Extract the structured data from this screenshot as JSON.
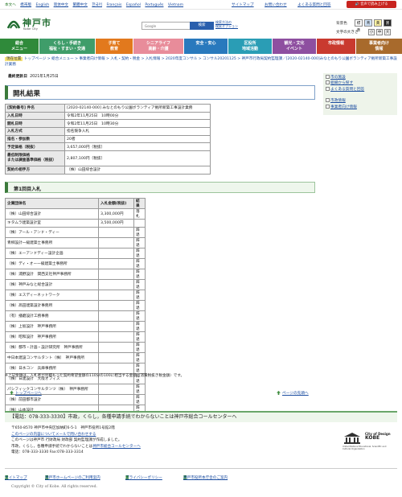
{
  "topbar": {
    "languages": [
      "本文へ",
      "携帯版",
      "English",
      "简体中文",
      "繁體中文",
      "한국어",
      "Français",
      "Español",
      "Português",
      "Vietnam"
    ],
    "links": [
      "サイトマップ",
      "お問い合わせ",
      "よくある質問と回答"
    ],
    "voice_button": "音声で読み上げる"
  },
  "header": {
    "logo_name": "神戸市",
    "logo_sub": "Kobe City",
    "search_placeholder": "Google",
    "search_button": "検索",
    "search_option": "検索方法の\n検索オプション",
    "bgcolor_label": "背景色",
    "bgcolor_options": [
      "標準",
      "青",
      "黄",
      "黒"
    ],
    "fontsize_label": "文字の大きさ",
    "fontsize_options": [
      "小",
      "中",
      "大"
    ]
  },
  "nav": [
    {
      "label": "総合\nメニュー",
      "color": "#2f8a3a"
    },
    {
      "label": "くらし・手続き\n福祉・すまい・交通",
      "color": "#3f9d6a"
    },
    {
      "label": "子育て\n教育",
      "color": "#e2791d"
    },
    {
      "label": "シニアライフ\n高齢・介護",
      "color": "#e88c9a"
    },
    {
      "label": "安全・安心",
      "color": "#2979bd"
    },
    {
      "label": "区役所\n地域活動",
      "color": "#2a9db5"
    },
    {
      "label": "観光・文化\nイベント",
      "color": "#8e4fa0"
    },
    {
      "label": "市政情報",
      "color": "#c93a2f"
    },
    {
      "label": "事業者向け\n情報",
      "color": "#a86a2c"
    }
  ],
  "breadcrumb": {
    "current_label": "現在位置",
    "path": "トップページ > 総合メニュー > 事業者向け情報 > 入札・契約・税金 > 入札情報 > 2020年度コンサル > コンサル20201125 > 神戸市行政局契約監理課／[2020-02140-000]みなとのもり公園ボランティア拠所新築工事設計業務"
  },
  "updated": {
    "label": "最終更新日",
    "date": "2021年1月25日"
  },
  "side_links": [
    "市の施設",
    "組織から探す",
    "よくある質問と回答",
    "市政情報",
    "事業者向け情報"
  ],
  "title": "開札結果",
  "info_table": [
    {
      "key": "[契約番号] 件名",
      "value": "[2020-02140-000] みなとのもり公園ボランティア拠所新築工事設計業務"
    },
    {
      "key": "入札日時",
      "value": "令和2年11月25日　10時00分"
    },
    {
      "key": "開札日時",
      "value": "令和2年11月25日　10時30分"
    },
    {
      "key": "入札方式",
      "value": "指名競争入札"
    },
    {
      "key": "指名・参加数",
      "value": "20者"
    },
    {
      "key": "予定価格（税抜）",
      "value": "3,657,000円（税抜）"
    },
    {
      "key": "最低制限価格\nまたは調査基準価格（税抜）",
      "value": "2,807,100円（税抜）"
    },
    {
      "key": "契約の相手方",
      "value": "（株）山田綜合設計"
    }
  ],
  "round_title": "第1回目入札",
  "results": {
    "headers": [
      "企業団体名",
      "入札金額(税抜)",
      "結果"
    ],
    "rows": [
      [
        "（株）山田綜合設計",
        "3,300,000円",
        "落札"
      ],
      [
        "キタムラ建築設計室",
        "3,500,000円",
        ""
      ],
      [
        "（株）アール・アンド・ディー",
        "",
        "辞退"
      ],
      [
        "青柳設計一級建築士事務所",
        "",
        "辞退"
      ],
      [
        "（株）エーアンドディー設計企画",
        "",
        "辞退"
      ],
      [
        "（株）ディ・オー一級建築士事務所",
        "",
        "辞退"
      ],
      [
        "（株）浦野設計　関西支社神戸事務所",
        "",
        "辞退"
      ],
      [
        "（株）神戸みなと総合設計",
        "",
        "辞退"
      ],
      [
        "（株）エスディーネットワーク",
        "",
        "辞退"
      ],
      [
        "（株）髙田建築設計事務所",
        "",
        "辞退"
      ],
      [
        "（有）播磨設計工務事務",
        "",
        "辞退"
      ],
      [
        "（株）上坂設計　神戸事務所",
        "",
        "辞退"
      ],
      [
        "（株）昭和設計　神戸事務所",
        "",
        "辞退"
      ],
      [
        "（株）都市・計画・設計研究所　神戸事務所",
        "",
        "辞退"
      ],
      [
        "中日本建設コンサルタント（株）　神戸事務所",
        "",
        "辞退"
      ],
      [
        "（株）日水コン　兵庫事務所",
        "",
        "辞退"
      ],
      [
        "（株）日建設計　大阪オフィス",
        "",
        "辞退"
      ],
      [
        "パシフィックコンサルタンツ（株）　神戸事務所",
        "",
        "辞退"
      ],
      [
        "（株）前田都市設計",
        "",
        "辞退"
      ],
      [
        "（株）山本設計",
        "",
        "辞退"
      ]
    ]
  },
  "note": "※上記金額は，入札者が見積もった契約希望金額の110分の100に相当する金額（消費税抜き税金額）です。",
  "page_top_left": "トップページへ",
  "page_top_right": "ページの先頭へ",
  "contact_band": "【電話：078-333-3330】市政，くらし，各種申請手続でわからないことは神戸市総合コールセンターへ",
  "footer": {
    "address": "〒650-8570 神戸市中央区加納町6-5-1　神戸市役所1号館2階",
    "inquiry_link": "このページの内容についてメールで問い合わせする",
    "created_by": "このページは神戸市 行財政局 財政部 契約監理課が作成しました。",
    "callcenter_text": "市政，くらし，各種申請手続でわからないことは",
    "callcenter_link": "神戸市総合コールセンターへ",
    "tel": "電話：078-333-3330 Fax:078-333-3314"
  },
  "unesco": {
    "line1": "City of Design",
    "line2": "KOBE",
    "small": "United Nations Educational, Scientific and Cultural Organization"
  },
  "footer_nav": [
    "サイトマップ",
    "神戸市ホームページのご利用案内",
    "プライバシーポリシー",
    "神戸市役所本庁舎のご案内"
  ],
  "copyright": "Copyright © City of Kobe. All rights reserved."
}
